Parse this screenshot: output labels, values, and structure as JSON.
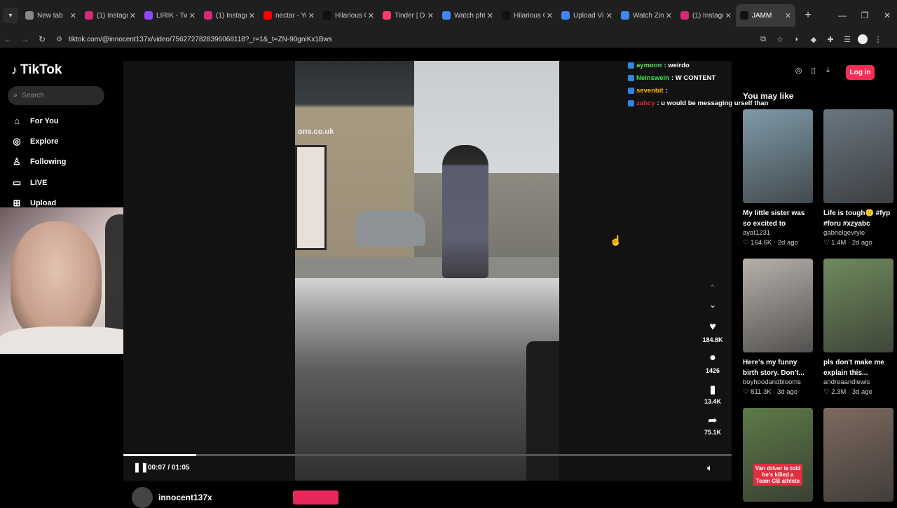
{
  "browser": {
    "tabs": [
      {
        "label": "New tab",
        "color": "#888888"
      },
      {
        "label": "(1) Instagra",
        "color": "#d62976"
      },
      {
        "label": "LIRIK - Twi",
        "color": "#9146ff"
      },
      {
        "label": "(1) Instagra",
        "color": "#d62976"
      },
      {
        "label": "nectar - Yo",
        "color": "#ff0000"
      },
      {
        "label": "Hilarious C",
        "color": "#111111"
      },
      {
        "label": "Tinder | Da",
        "color": "#fe3c72"
      },
      {
        "label": "Watch pht",
        "color": "#4285f4"
      },
      {
        "label": "Hilarious C",
        "color": "#111111"
      },
      {
        "label": "Upload Vi",
        "color": "#4285f4"
      },
      {
        "label": "Watch Zin",
        "color": "#4285f4"
      },
      {
        "label": "(1) Instagra",
        "color": "#d62976"
      },
      {
        "label": "JAMM",
        "color": "#111111",
        "active": true
      }
    ],
    "url": "tiktok.com/@innocent137x/video/7562727828396068118?_r=1&_t=ZN-90gniKx1Bws"
  },
  "tiktok": {
    "logo": "TikTok",
    "search_placeholder": "Search",
    "nav": [
      {
        "label": "For You",
        "icon": "home-icon",
        "glyph": "⌂"
      },
      {
        "label": "Explore",
        "icon": "compass-icon",
        "glyph": "◎"
      },
      {
        "label": "Following",
        "icon": "user-icon",
        "glyph": "♙"
      },
      {
        "label": "LIVE",
        "icon": "live-icon",
        "glyph": "▭"
      },
      {
        "label": "Upload",
        "icon": "upload-icon",
        "glyph": "⊞"
      }
    ],
    "login_label": "Log in"
  },
  "video": {
    "sign_text": "ons.co.uk",
    "time": "00:07 / 01:05",
    "progress": 0.12,
    "author": "innocent137x",
    "actions": [
      {
        "name": "like",
        "icon": "heart-icon",
        "glyph": "♥",
        "count": "184.8K"
      },
      {
        "name": "comment",
        "icon": "comment-icon",
        "glyph": "●",
        "count": "1426"
      },
      {
        "name": "bookmark",
        "icon": "bookmark-icon",
        "glyph": "▮",
        "count": "13.4K"
      },
      {
        "name": "share",
        "icon": "share-icon",
        "glyph": "➦",
        "count": "75.1K"
      }
    ]
  },
  "chat": [
    {
      "user": "aymoon",
      "color": "#67e06a",
      "msg": ": weirdo"
    },
    {
      "user": "Neinswein",
      "color": "#3ce84f",
      "msg": ": W CONTENT"
    },
    {
      "user": "sevenbit",
      "color": "#ffb300",
      "msg": ":"
    },
    {
      "user": "zahcy",
      "color": "#e02a2a",
      "msg": ": u would be messaging urself than"
    }
  ],
  "recommendations": {
    "heading": "You may like",
    "items": [
      {
        "title": "My little sister was so excited to releas...",
        "user": "ayat1231",
        "likes": "164.6K",
        "age": "2d ago",
        "bg": "#7f9aa8"
      },
      {
        "title": "Life is tough😕 #fyp #foru #xzyabc",
        "user": "gabrielgevryie",
        "likes": "1.4M",
        "age": "2d ago",
        "bg": "#6a7680"
      },
      {
        "title": "Here's my funny birth story. Don't...",
        "user": "boyhoodandblooms",
        "likes": "811.3K",
        "age": "3d ago",
        "bg": "#b7b1ab"
      },
      {
        "title": "pls don't make me explain this...",
        "user": "andreaandlewis",
        "likes": "2.3M",
        "age": "3d ago",
        "bg": "#6f8a5d"
      },
      {
        "title": "",
        "user": "",
        "likes": "",
        "age": "",
        "bg": "#5d7a48",
        "caption": "Van driver is told he's killed a Team GB athlete"
      },
      {
        "title": "",
        "user": "",
        "likes": "",
        "age": "",
        "bg": "#7d6a5f"
      }
    ]
  }
}
